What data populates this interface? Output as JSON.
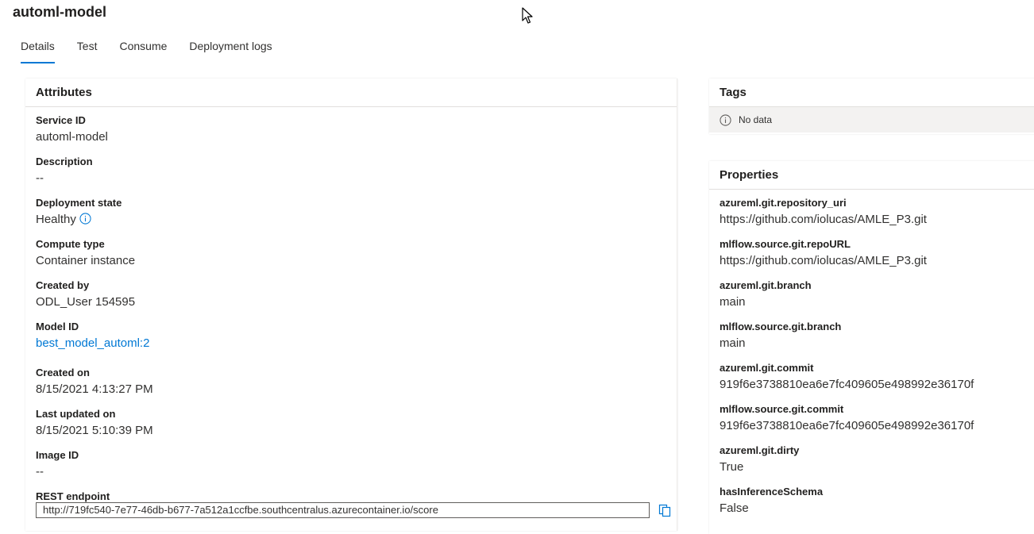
{
  "header": {
    "title": "automl-model"
  },
  "tabs": [
    {
      "label": "Details",
      "active": true
    },
    {
      "label": "Test",
      "active": false
    },
    {
      "label": "Consume",
      "active": false
    },
    {
      "label": "Deployment logs",
      "active": false
    }
  ],
  "attributes": {
    "title": "Attributes",
    "service_id": {
      "label": "Service ID",
      "value": "automl-model"
    },
    "description": {
      "label": "Description",
      "value": "--"
    },
    "deployment_state": {
      "label": "Deployment state",
      "value": "Healthy"
    },
    "compute_type": {
      "label": "Compute type",
      "value": "Container instance"
    },
    "created_by": {
      "label": "Created by",
      "value": "ODL_User 154595"
    },
    "model_id": {
      "label": "Model ID",
      "value": "best_model_automl:2"
    },
    "created_on": {
      "label": "Created on",
      "value": "8/15/2021 4:13:27 PM"
    },
    "last_updated_on": {
      "label": "Last updated on",
      "value": "8/15/2021 5:10:39 PM"
    },
    "image_id": {
      "label": "Image ID",
      "value": "--"
    },
    "rest_endpoint": {
      "label": "REST endpoint",
      "value": "http://719fc540-7e77-46db-b677-7a512a1ccfbe.southcentralus.azurecontainer.io/score"
    }
  },
  "tags": {
    "title": "Tags",
    "empty_text": "No data"
  },
  "properties": {
    "title": "Properties",
    "items": [
      {
        "label": "azureml.git.repository_uri",
        "value": "https://github.com/iolucas/AMLE_P3.git"
      },
      {
        "label": "mlflow.source.git.repoURL",
        "value": "https://github.com/iolucas/AMLE_P3.git"
      },
      {
        "label": "azureml.git.branch",
        "value": "main"
      },
      {
        "label": "mlflow.source.git.branch",
        "value": "main"
      },
      {
        "label": "azureml.git.commit",
        "value": "919f6e3738810ea6e7fc409605e498992e36170f"
      },
      {
        "label": "mlflow.source.git.commit",
        "value": "919f6e3738810ea6e7fc409605e498992e36170f"
      },
      {
        "label": "azureml.git.dirty",
        "value": "True"
      },
      {
        "label": "hasInferenceSchema",
        "value": "False"
      }
    ]
  },
  "colors": {
    "accent": "#0078d4",
    "text": "#323130",
    "nodata_bg": "#f3f2f1"
  },
  "icons": [
    "mouse-cursor-icon",
    "info-icon",
    "copy-icon"
  ]
}
